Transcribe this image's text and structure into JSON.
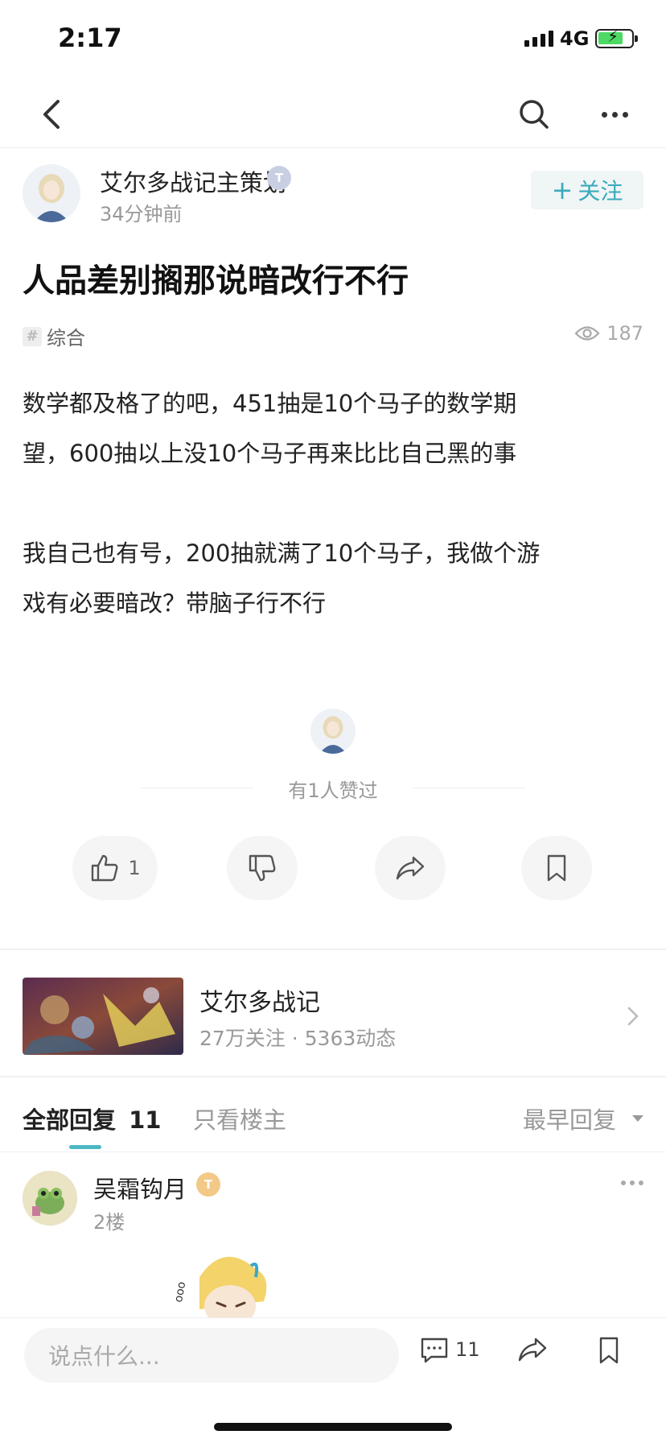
{
  "status_bar": {
    "time": "2:17",
    "network": "4G"
  },
  "post": {
    "author": {
      "name": "艾尔多战记主策划",
      "badge": "T",
      "time": "34分钟前",
      "follow_label": "关注",
      "follow_plus": "+"
    },
    "title": "人品差别搁那说暗改行不行",
    "tag": {
      "hash": "#",
      "label": "综合"
    },
    "views": "187",
    "body": [
      "数学都及格了的吧，451抽是10个马子的数学期",
      "望，600抽以上没10个马子再来比比自己黑的事",
      "",
      "我自己也有号，200抽就满了10个马子，我做个游",
      "戏有必要暗改？带脑子行不行"
    ],
    "liked_text": "有1人赞过",
    "actions": {
      "like_count": "1"
    }
  },
  "game": {
    "name": "艾尔多战记",
    "stats": "27万关注 · 5363动态"
  },
  "tabs": {
    "all_label": "全部回复",
    "all_count": "11",
    "owner_label": "只看楼主",
    "sort_label": "最早回复"
  },
  "reply": {
    "name": "吴霜钩月",
    "badge": "T",
    "floor": "2楼"
  },
  "bottom": {
    "placeholder": "说点什么...",
    "comment_count": "11"
  },
  "colors": {
    "accent": "#3aabbb",
    "tab_indicator": "#4cb8c4",
    "battery": "#4cd964"
  },
  "icons": [
    "back-icon",
    "search-icon",
    "more-icon",
    "eye-icon",
    "thumb-up-icon",
    "thumb-down-icon",
    "share-icon",
    "bookmark-icon",
    "chevron-right-icon",
    "comment-icon"
  ]
}
